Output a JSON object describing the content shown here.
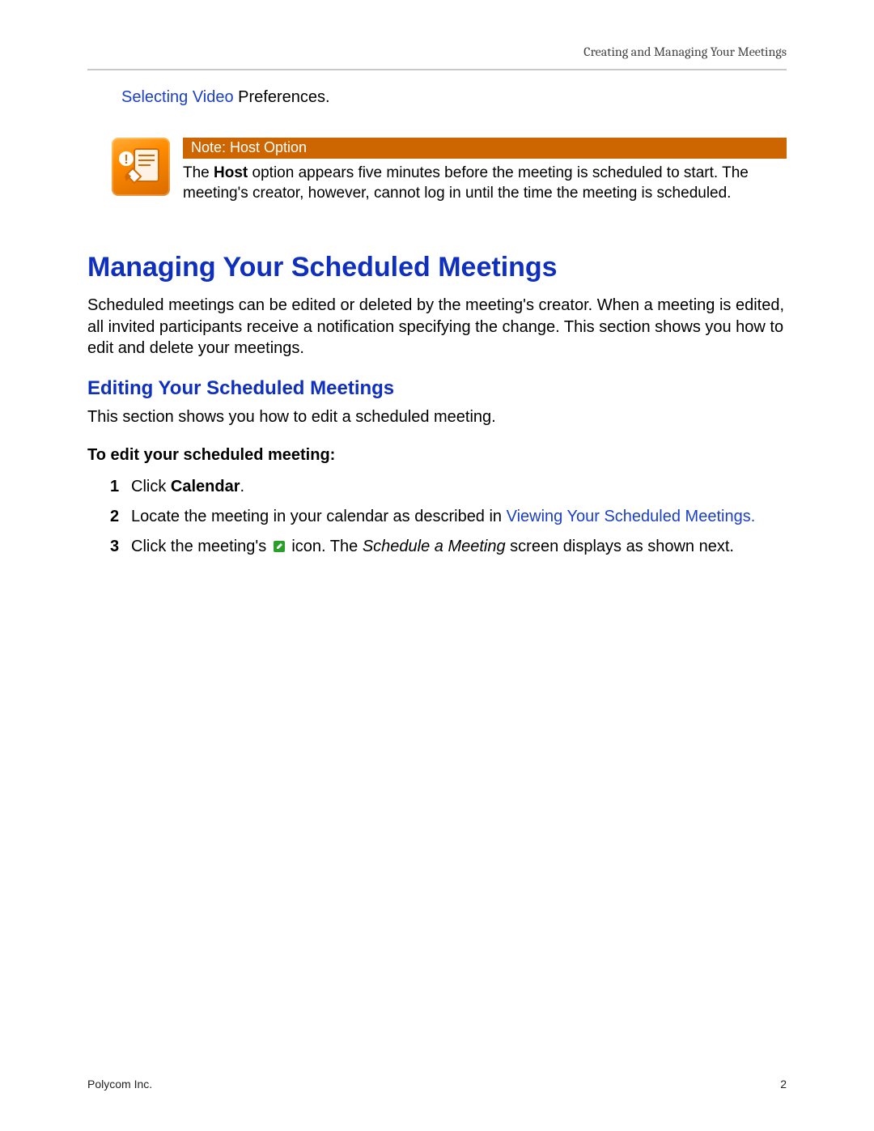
{
  "header": {
    "breadcrumb": "Creating and Managing Your Meetings"
  },
  "intro": {
    "link_text": "Selecting Video",
    "rest": " Preferences."
  },
  "note": {
    "title": "Note: Host Option",
    "body_pre": "The ",
    "body_bold": "Host",
    "body_post": " option appears five minutes before the meeting is scheduled to start. The meeting's creator, however, cannot log in until the time the meeting is scheduled.",
    "icon_name": "alert-note-icon"
  },
  "section": {
    "title": "Managing Your Scheduled Meetings",
    "body": "Scheduled meetings can be edited or deleted by the meeting's creator. When a meeting is edited, all invited participants receive a notification specifying the change. This section shows you how to edit and delete your meetings."
  },
  "subsection": {
    "title": "Editing Your Scheduled Meetings",
    "lead": "This section shows you how to edit a scheduled meeting.",
    "task_title": "To edit your scheduled meeting:"
  },
  "steps": [
    {
      "num": "1",
      "pre": "Click ",
      "bold": "Calendar",
      "post": "."
    },
    {
      "num": "2",
      "pre": "Locate the meeting in your calendar as described in ",
      "link": "Viewing Your Scheduled Meetings.",
      "post": ""
    },
    {
      "num": "3",
      "pre": "Click the meeting's ",
      "icon": "edit-icon",
      "mid": " icon. The ",
      "italic": "Schedule a Meeting",
      "post": " screen displays as shown next."
    }
  ],
  "footer": {
    "left": "Polycom Inc.",
    "right": "2"
  }
}
